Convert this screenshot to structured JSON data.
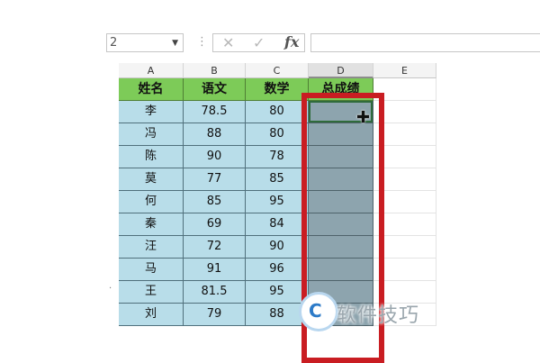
{
  "formula_bar": {
    "name_box_value": "2",
    "fx_label": "fx",
    "cancel_symbol": "✕",
    "enter_symbol": "✓",
    "dots": "⋮",
    "formula": ""
  },
  "columns": [
    "A",
    "B",
    "C",
    "D",
    "E"
  ],
  "table": {
    "headers": [
      "姓名",
      "语文",
      "数学",
      "总成绩"
    ],
    "rows": [
      {
        "name": "李",
        "chinese": "78.5",
        "math": "80"
      },
      {
        "name": "冯",
        "chinese": "88",
        "math": "80"
      },
      {
        "name": "陈",
        "chinese": "90",
        "math": "78"
      },
      {
        "name": "莫",
        "chinese": "77",
        "math": "85"
      },
      {
        "name": "何",
        "chinese": "85",
        "math": "95"
      },
      {
        "name": "秦",
        "chinese": "69",
        "math": "84"
      },
      {
        "name": "汪",
        "chinese": "72",
        "math": "90"
      },
      {
        "name": "马",
        "chinese": "91",
        "math": "96"
      },
      {
        "name": "王",
        "chinese": "81.5",
        "math": "95"
      },
      {
        "name": "刘",
        "chinese": "79",
        "math": "88"
      }
    ]
  },
  "selection": {
    "range": "D2:D11",
    "highlight_color": "#c91d22"
  },
  "watermark": {
    "logo_text": "C",
    "text": "软件技巧"
  }
}
